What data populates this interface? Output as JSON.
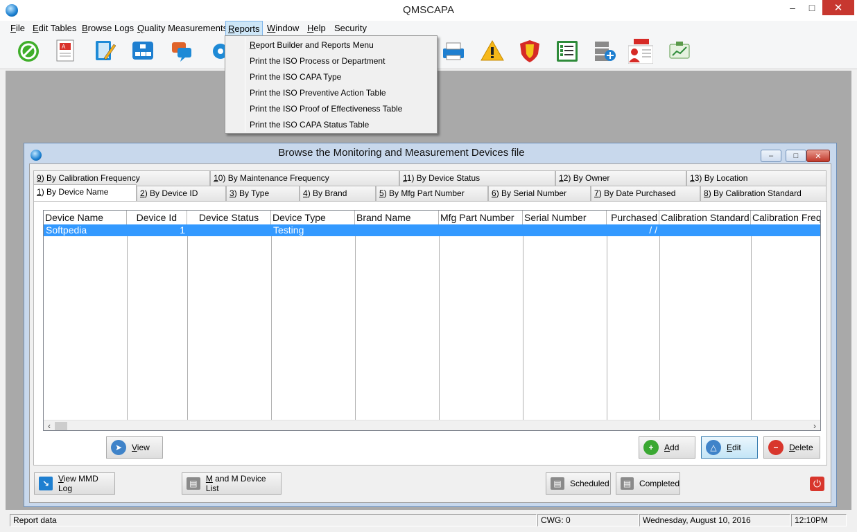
{
  "window": {
    "title": "QMSCAPA"
  },
  "menu": {
    "items": [
      {
        "label": "File",
        "accel": "F",
        "rest": "ile"
      },
      {
        "label": "Edit Tables",
        "accel": "E",
        "rest": "dit Tables"
      },
      {
        "label": "Browse Logs",
        "accel": "B",
        "rest": "rowse Logs"
      },
      {
        "label": "Quality Measurements",
        "accel": "Q",
        "rest": "uality Measurements"
      },
      {
        "label": "Reports",
        "accel": "R",
        "rest": "eports"
      },
      {
        "label": "Window",
        "accel": "W",
        "rest": "indow"
      },
      {
        "label": "Help",
        "accel": "H",
        "rest": "elp"
      },
      {
        "label": "Security",
        "accel": "",
        "rest": "Security"
      }
    ]
  },
  "reports_menu": {
    "items": [
      {
        "accel": "R",
        "rest": "eport Builder and Reports Menu"
      },
      {
        "accel": "",
        "rest": "Print the ISO Process or Department"
      },
      {
        "accel": "",
        "rest": "Print the ISO CAPA Type"
      },
      {
        "accel": "",
        "rest": "Print the ISO Preventive Action Table"
      },
      {
        "accel": "",
        "rest": "Print the ISO Proof of Effectiveness Table"
      },
      {
        "accel": "",
        "rest": "Print the ISO CAPA Status Table"
      }
    ]
  },
  "toolbar": {
    "icons": [
      "stop-icon",
      "pdf-document-icon",
      "notebook-pencil-icon",
      "org-chart-icon",
      "chat-bubbles-icon",
      "gear-icon",
      "printer-icon",
      "warning-icon",
      "shield-icon",
      "checklist-icon",
      "database-add-icon",
      "person-card-icon",
      "clipboard-chart-icon"
    ]
  },
  "child": {
    "title": "Browse the Monitoring and Measurement Devices file",
    "tabs_row1": [
      {
        "accel": "9",
        "rest": ") By Calibration Frequency"
      },
      {
        "accel": "1",
        "rest": "0) By Maintenance Frequency"
      },
      {
        "accel": "1",
        "rest": "1) By Device Status"
      },
      {
        "accel": "1",
        "rest": "2) By Owner"
      },
      {
        "accel": "1",
        "rest": "3) By Location"
      }
    ],
    "tabs_row2": [
      {
        "accel": "1",
        "rest": ") By Device Name"
      },
      {
        "accel": "2",
        "rest": ") By Device ID"
      },
      {
        "accel": "3",
        "rest": ") By Type"
      },
      {
        "accel": "4",
        "rest": ") By Brand"
      },
      {
        "accel": "5",
        "rest": ") By Mfg Part Number"
      },
      {
        "accel": "6",
        "rest": ") By Serial Number"
      },
      {
        "accel": "7",
        "rest": ") By Date Purchased"
      },
      {
        "accel": "8",
        "rest": ") By Calibration Standard"
      }
    ],
    "columns": [
      "Device Name",
      "Device Id",
      "Device Status",
      "Device Type",
      "Brand Name",
      "Mfg Part Number",
      "Serial Number",
      "Purchased",
      "Calibration Standard",
      "Calibration Freq"
    ],
    "rows": [
      [
        "Softpedia",
        "1",
        "",
        "Testing",
        "",
        "",
        "",
        " / /",
        "",
        ""
      ]
    ],
    "buttons": {
      "view": {
        "accel": "V",
        "rest": "iew"
      },
      "add": {
        "accel": "A",
        "rest": "dd"
      },
      "edit": {
        "accel": "E",
        "rest": "dit"
      },
      "delete": {
        "accel": "D",
        "rest": "elete"
      }
    },
    "bottom_buttons": {
      "view_log": {
        "accel": "V",
        "rest": "iew MMD Log"
      },
      "device_list": {
        "accel": "M",
        "rest": " and M Device List"
      },
      "scheduled": "Scheduled",
      "completed": "Completed"
    }
  },
  "status": {
    "left": "Report data",
    "cwg": "CWG: 0",
    "date": "Wednesday, August 10, 2016",
    "time": "12:10PM"
  }
}
